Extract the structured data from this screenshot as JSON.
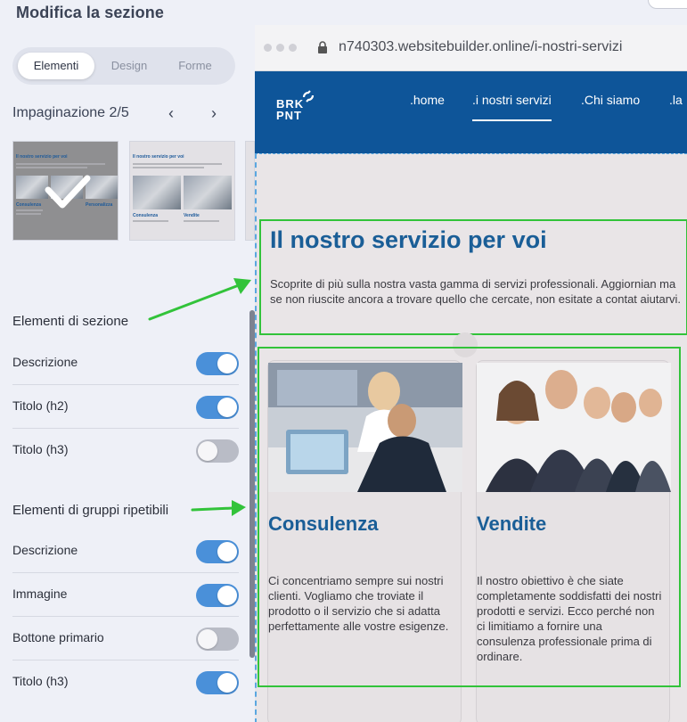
{
  "panel": {
    "title": "Modifica la sezione",
    "tabs": [
      {
        "label": "Elementi",
        "active": true
      },
      {
        "label": "Design",
        "active": false
      },
      {
        "label": "Forme",
        "active": false
      }
    ],
    "pager": "Impaginazione 2/5",
    "thumbnails": {
      "heading": "Il nostro servizio per voi",
      "caption1": "Consulenza",
      "caption2": "Personalizza",
      "caption3": "Vendite"
    },
    "section_elements": {
      "label": "Elementi di sezione",
      "items": [
        {
          "label": "Descrizione",
          "on": true
        },
        {
          "label": "Titolo (h2)",
          "on": true
        },
        {
          "label": "Titolo (h3)",
          "on": false
        }
      ]
    },
    "group_elements": {
      "label": "Elementi di gruppi ripetibili",
      "items": [
        {
          "label": "Descrizione",
          "on": true
        },
        {
          "label": "Immagine",
          "on": true
        },
        {
          "label": "Bottone primario",
          "on": false
        },
        {
          "label": "Titolo (h3)",
          "on": true
        }
      ]
    }
  },
  "browser": {
    "url": "n740303.websitebuilder.online/i-nostri-servizi",
    "logo": {
      "line1": "BRK",
      "line2": "PNT"
    },
    "nav": [
      ".home",
      ".i nostri servizi",
      ".Chi siamo",
      ".la"
    ],
    "section_title": "Il nostro servizio per voi",
    "section_desc": "Scoprite di più sulla nostra vasta gamma di servizi professionali. Aggiornian ma se non riuscite ancora a trovare quello che cercate, non esitate a contat aiutarvi.",
    "cards": [
      {
        "title": "Consulenza",
        "text": "Ci concentriamo sempre sui nostri clienti. Vogliamo che troviate il prodotto o il servizio che si adatta perfettamente alle vostre esigenze."
      },
      {
        "title": "Vendite",
        "text": "Il nostro obiettivo è che siate completamente soddisfatti dei nostri prodotti e servizi. Ecco perché non ci limitiamo a fornire una consulenza professionale prima di ordinare."
      }
    ]
  },
  "colors": {
    "accent": "#4a90d9",
    "nav_bg": "#0e5599",
    "highlight": "#32c33a",
    "heading": "#1a5e97"
  }
}
